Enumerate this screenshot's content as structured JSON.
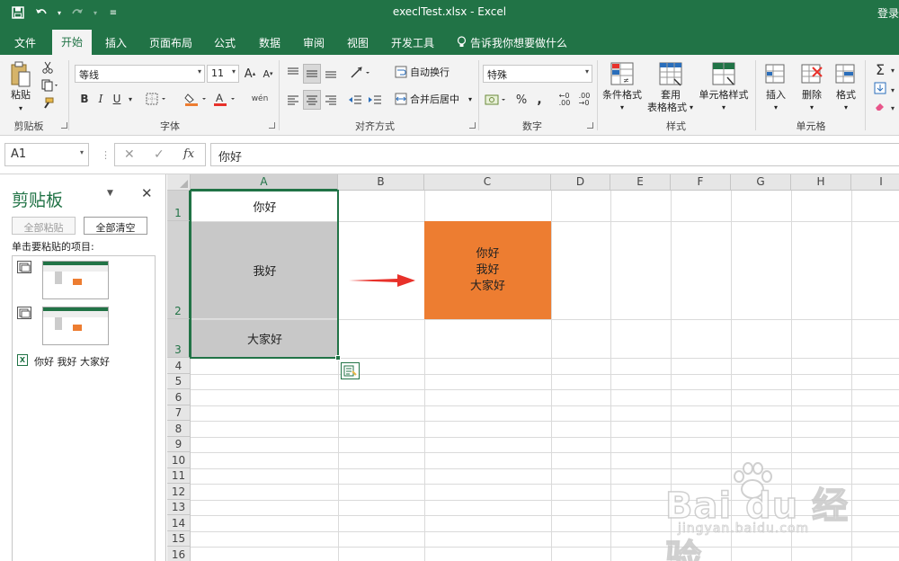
{
  "titlebar": {
    "doc_title": "execlTest.xlsx  -  Excel",
    "login": "登录",
    "icons": [
      "save-icon",
      "undo-icon",
      "redo-icon",
      "customize-qat-icon"
    ]
  },
  "tabs": [
    "文件",
    "开始",
    "插入",
    "页面布局",
    "公式",
    "数据",
    "审阅",
    "视图",
    "开发工具"
  ],
  "tell_me": "告诉我你想要做什么",
  "ribbon": {
    "clipboard": {
      "paste": "粘贴",
      "label": "剪贴板"
    },
    "font": {
      "family": "等线",
      "size": "11",
      "bold": "B",
      "italic": "I",
      "underline": "U",
      "label": "字体",
      "wen": "wén"
    },
    "align": {
      "wrap": "自动换行",
      "merge": "合并后居中",
      "label": "对齐方式"
    },
    "number": {
      "format": "特殊",
      "label": "数字"
    },
    "styles": {
      "cond": "条件格式",
      "table_line1": "套用",
      "table_line2": "表格格式",
      "cell_styles": "单元格样式",
      "label": "样式"
    },
    "cells": {
      "insert": "插入",
      "delete": "删除",
      "format": "格式",
      "label": "单元格"
    }
  },
  "formula_bar": {
    "name_box": "A1",
    "cancel": "✕",
    "enter": "✓",
    "fx": "fx",
    "value": "你好"
  },
  "clipboard_pane": {
    "title": "剪贴板",
    "paste_all": "全部粘贴",
    "clear_all": "全部清空",
    "hint": "单击要粘贴的项目:",
    "text_item": "你好 我好 大家好"
  },
  "grid": {
    "columns": [
      "A",
      "B",
      "C",
      "D",
      "E",
      "F",
      "G",
      "H",
      "I"
    ],
    "rows": [
      "1",
      "2",
      "3",
      "4",
      "5",
      "6",
      "7",
      "8",
      "9",
      "10",
      "11",
      "12",
      "13",
      "14",
      "15",
      "16"
    ],
    "a1": "你好",
    "a2": "我好",
    "a3": "大家好",
    "c2_lines": [
      "你好",
      "我好",
      "大家好"
    ]
  },
  "colors": {
    "brand": "#217346",
    "orange": "#ed7d31",
    "gray_fill": "#c8c8c8",
    "arrow": "#e8312a"
  },
  "watermark": {
    "main": "Bai du 经验",
    "sub": "jingyan.baidu.com"
  }
}
